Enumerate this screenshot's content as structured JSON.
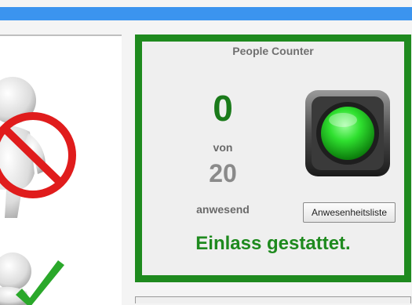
{
  "colors": {
    "top_bar": "#3b94ef",
    "panel_border": "#1e8a1e",
    "count": "#1a7a1a",
    "status_text": "#1e8a1e",
    "light_on": "#2fe02f"
  },
  "illustrations": {
    "entry_prohibited": "figure-with-no-entry-sign",
    "entry_allowed": "figure-with-checkmark"
  },
  "counter": {
    "title": "People Counter",
    "current_count": "0",
    "of_label": "von",
    "capacity": "20",
    "present_label": "anwesend",
    "attendance_button_label": "Anwesenheitsliste",
    "status_message": "Einlass gestattet.",
    "traffic_light_state": "green"
  }
}
